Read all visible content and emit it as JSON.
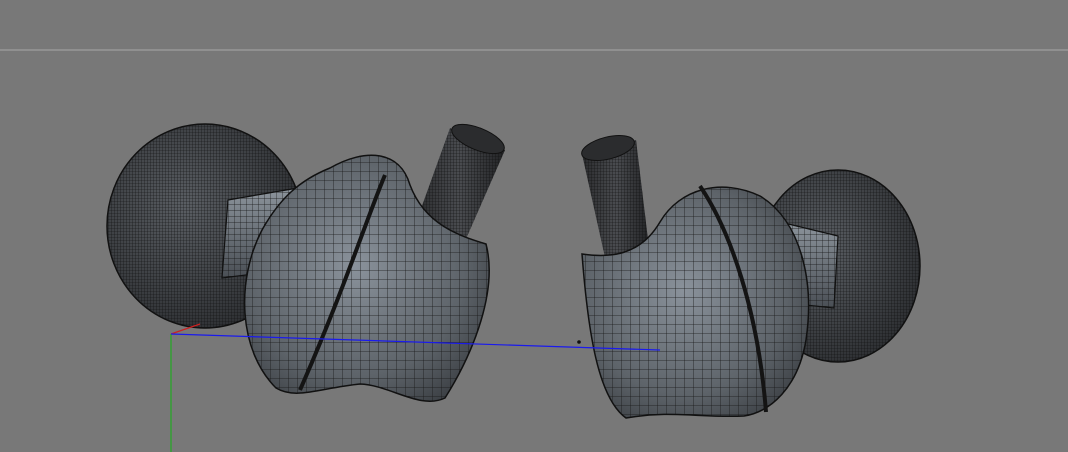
{
  "viewport": {
    "view": "perspective-3d",
    "background": "#787878",
    "grid_visible": true,
    "grid_color": "#b0b0b0",
    "display_mode": "wireframe-shaded",
    "mesh_color": "#33373c",
    "wire_color": "#111111"
  },
  "axes": {
    "x_color": "#cc2222",
    "y_color": "#22aa22",
    "z_color": "#1a1aee"
  },
  "objects": [
    {
      "name": "earbud-left",
      "parts": [
        "ear-tip",
        "nozzle",
        "shell",
        "stem"
      ]
    },
    {
      "name": "earbud-right",
      "parts": [
        "ear-tip",
        "nozzle",
        "shell",
        "stem"
      ]
    }
  ]
}
